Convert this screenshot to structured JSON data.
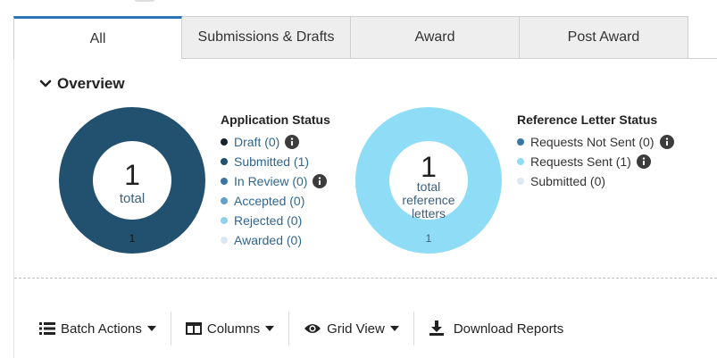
{
  "tabs": [
    {
      "label": "All",
      "active": true
    },
    {
      "label": "Submissions & Drafts",
      "active": false
    },
    {
      "label": "Award",
      "active": false
    },
    {
      "label": "Post Award",
      "active": false
    }
  ],
  "overview": {
    "title": "Overview",
    "application": {
      "count": "1",
      "center_label": "total",
      "segment_label": "1",
      "ring_color": "#22506f",
      "legend_title": "Application Status",
      "items": [
        {
          "label": "Draft (0)",
          "color": "#17232c",
          "info": true
        },
        {
          "label": "Submitted (1)",
          "color": "#22506f",
          "info": false
        },
        {
          "label": "In Review (0)",
          "color": "#3a75a6",
          "info": true
        },
        {
          "label": "Accepted (0)",
          "color": "#63a0c8",
          "info": false
        },
        {
          "label": "Rejected (0)",
          "color": "#8fd0ea",
          "info": false
        },
        {
          "label": "Awarded (0)",
          "color": "#d9e8f3",
          "info": false
        }
      ]
    },
    "reference": {
      "count": "1",
      "center_line1": "total",
      "center_line2": "reference",
      "center_line3": "letters",
      "segment_label": "1",
      "ring_color": "#8fdcf6",
      "legend_title": "Reference Letter Status",
      "items": [
        {
          "label": "Requests Not Sent (0)",
          "color": "#3a75a6",
          "info": true
        },
        {
          "label": "Requests Sent (1)",
          "color": "#8fdcf6",
          "info": true
        },
        {
          "label": "Submitted (0)",
          "color": "#dde8f1",
          "info": false
        }
      ]
    }
  },
  "toolbar": {
    "batch_actions": "Batch Actions",
    "columns": "Columns",
    "grid_view": "Grid View",
    "download_reports": "Download Reports"
  }
}
